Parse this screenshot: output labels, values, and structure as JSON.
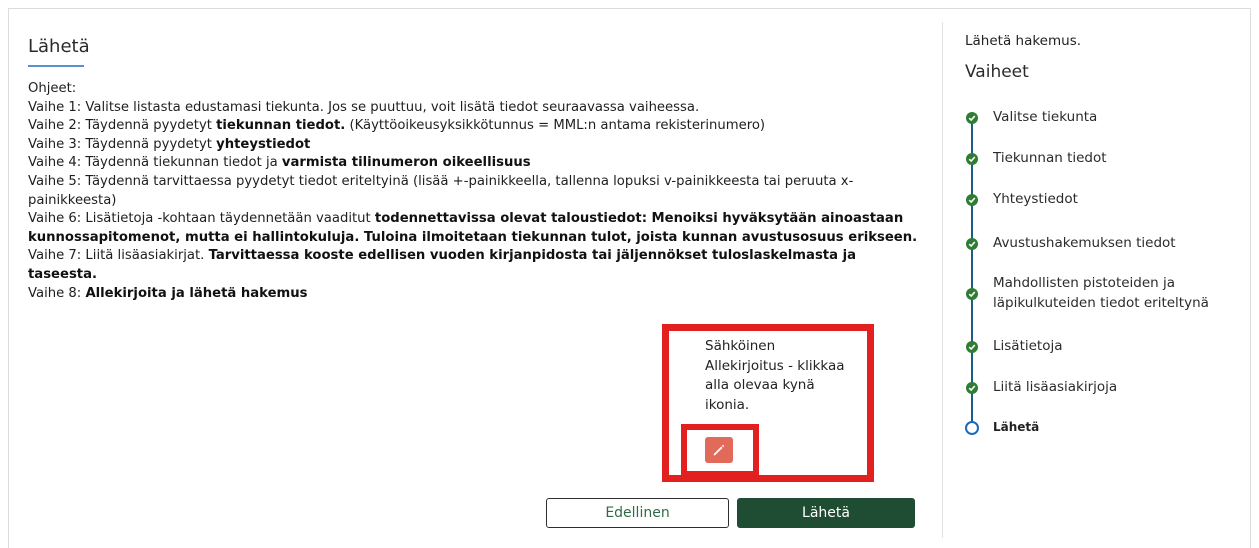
{
  "main": {
    "title": "Lähetä",
    "instructions_heading": "Ohjeet:",
    "steps": {
      "s1": "Vaihe 1: Valitse listasta edustamasi tiekunta. Jos se puuttuu, voit lisätä tiedot seuraavassa vaiheessa.",
      "s2_pre": "Vaihe 2: Täydennä pyydetyt ",
      "s2_bold": "tiekunnan tiedot.",
      "s2_post": " (Käyttöoikeusyksikkötunnus = MML:n antama rekisterinumero)",
      "s3_pre": "Vaihe 3: Täydennä pyydetyt ",
      "s3_bold": "yhteystiedot",
      "s4_pre": "Vaihe 4: Täydennä tiekunnan tiedot ja ",
      "s4_bold": "varmista tilinumeron oikeellisuus",
      "s5": "Vaihe 5: Täydennä tarvittaessa pyydetyt tiedot eriteltyinä (lisää +-painikkeella, tallenna lopuksi v-painikkeesta tai peruuta x-painikkeesta)",
      "s6_pre": "Vaihe 6: Lisätietoja -kohtaan täydennetään vaaditut ",
      "s6_bold": "todennettavissa olevat taloustiedot: Menoiksi hyväksytään ainoastaan kunnossapitomenot, mutta ei hallintokuluja. Tuloina ilmoitetaan tiekunnan tulot, joista kunnan avustusosuus erikseen.",
      "s7_pre": "Vaihe 7: Liitä lisäasiakirjat. ",
      "s7_bold": "Tarvittaessa kooste edellisen vuoden kirjanpidosta tai jäljennökset tuloslaskelmasta ja taseesta.",
      "s8_pre": "Vaihe 8: ",
      "s8_bold": "Allekirjoita ja lähetä hakemus"
    },
    "signature": {
      "text": "Sähköinen Allekirjoitus - klikkaa alla olevaa kynä ikonia.",
      "icon": "pencil-icon",
      "highlight_color": "#e1201f",
      "button_color": "#e26a5b"
    },
    "buttons": {
      "previous": "Edellinen",
      "send": "Lähetä"
    }
  },
  "sidebar": {
    "header": "Lähetä hakemus.",
    "title": "Vaiheet",
    "steps": [
      {
        "label": "Valitse tiekunta",
        "status": "done"
      },
      {
        "label": "Tiekunnan tiedot",
        "status": "done"
      },
      {
        "label": "Yhteystiedot",
        "status": "done"
      },
      {
        "label": "Avustushakemuksen tiedot",
        "status": "done"
      },
      {
        "label": "Mahdollisten pistoteiden ja läpikulkuteiden tiedot eriteltynä",
        "status": "done"
      },
      {
        "label": "Lisätietoja",
        "status": "done"
      },
      {
        "label": "Liitä lisäasiakirjoja",
        "status": "done"
      },
      {
        "label": "Lähetä",
        "status": "current"
      }
    ]
  },
  "colors": {
    "primary_green": "#1f4d33",
    "done_green": "#2f7d32",
    "current_blue": "#1a6ac0"
  }
}
